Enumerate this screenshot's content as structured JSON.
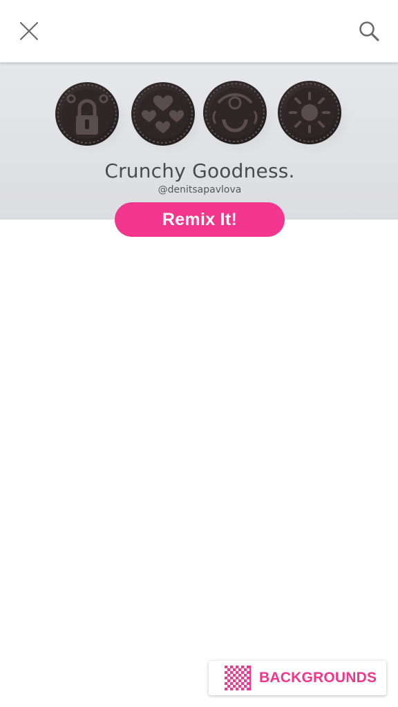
{
  "toolbar": {
    "close_icon": "close-icon",
    "search_icon": "search-icon"
  },
  "banner": {
    "title": "Crunchy Goodness.",
    "author": "@denitsapavlova"
  },
  "actions": {
    "remix_label": "Remix It!"
  },
  "footer": {
    "backgrounds_label": "BACKGROUNDS",
    "backgrounds_icon": "checkerboard-icon"
  },
  "colors": {
    "accent": "#f2358d",
    "banner_bg": "#e3e4e7",
    "title_text": "#4b4b4d"
  }
}
